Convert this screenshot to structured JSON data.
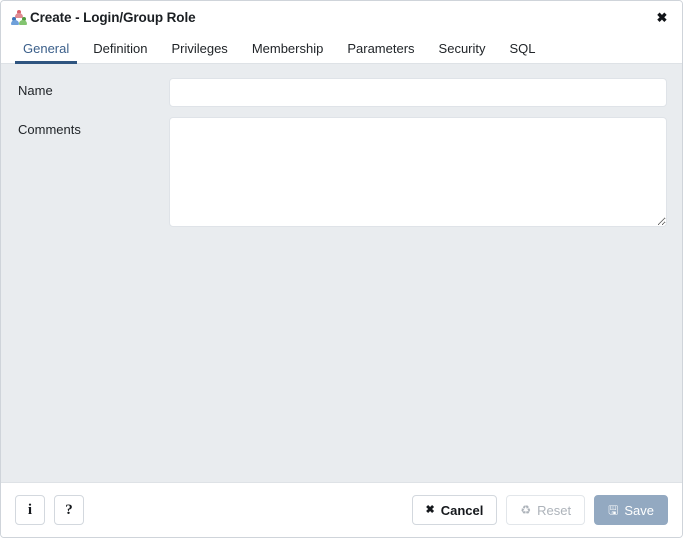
{
  "dialog": {
    "title": "Create - Login/Group Role",
    "title_icon": "group-role-icon",
    "close_icon": "✖",
    "close_label": "Close"
  },
  "tabs": [
    {
      "label": "General",
      "active": true
    },
    {
      "label": "Definition",
      "active": false
    },
    {
      "label": "Privileges",
      "active": false
    },
    {
      "label": "Membership",
      "active": false
    },
    {
      "label": "Parameters",
      "active": false
    },
    {
      "label": "Security",
      "active": false
    },
    {
      "label": "SQL",
      "active": false
    }
  ],
  "form": {
    "name": {
      "label": "Name",
      "value": "",
      "placeholder": ""
    },
    "comments": {
      "label": "Comments",
      "value": "",
      "placeholder": ""
    }
  },
  "footer": {
    "info_label": "i",
    "info_name": "info-icon",
    "help_label": "?",
    "help_name": "help-icon",
    "cancel_label": "Cancel",
    "cancel_icon": "✖",
    "reset_label": "Reset",
    "reset_icon": "♻",
    "save_label": "Save",
    "save_icon": "🖫"
  },
  "colors": {
    "accent": "#2f5580",
    "active_tab_text": "#3b5f8a",
    "body_bg": "#e9ecef",
    "panel_bg": "#ffffff",
    "save_bg": "#93a9c1",
    "disabled_text": "#adb3ba",
    "border": "#dee2e6",
    "icon_red": "#d9606a",
    "icon_blue": "#5b8fd0",
    "icon_green": "#6fba5a"
  }
}
